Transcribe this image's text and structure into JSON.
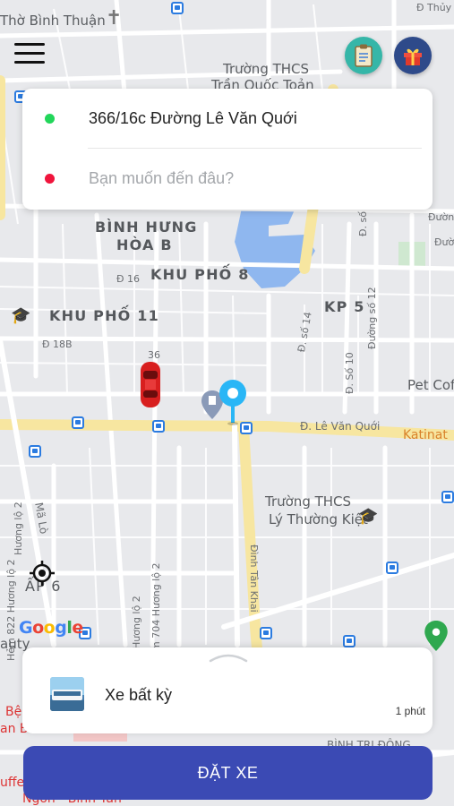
{
  "map": {
    "labels": {
      "tho_binh_thuan": "Thờ Bình Thuận",
      "da_thuy": "Đ Thủy",
      "truong_thcs_1": "Trường THCS",
      "tran_quoc_toan": "Trần Quốc Toản",
      "binh_hung": "BÌNH HƯNG",
      "hoa_b": "HÒA B",
      "khu_pho_8": "KHU PHỐ 8",
      "kp_5": "KP 5",
      "khu_pho_11": "KHU PHỐ 11",
      "d16": "Đ 16",
      "d18b": "Đ 18B",
      "d_so_14": "Đ. số 14",
      "d_so_10": "Đ. Số 10",
      "duong_so_12": "Đường số 12",
      "d_so_right": "Đ. số",
      "duong_so_right": "Đường số",
      "duong_so_16": "Đường số 16",
      "d36": "36",
      "le_van_quoi": "Đ. Lê Văn Quới",
      "pet_coffee": "Pet Cof",
      "katinat": "Katinat",
      "truong_thcs_2": "Trường THCS",
      "ly_thuong_kiet": "Lý Thường Kiệt",
      "ma_lo": "Mã Lò",
      "huong_lo_2_a": "Hương lộ 2",
      "hem_822": "Hẻm 822 Hương lộ 2",
      "hem_704": "Hẻm 704 Hương lộ 2",
      "huong_lo_2_b": "Hương lộ 2",
      "dinh_tan_khai": "Đình Tân Khai",
      "ap_6": "ẤP 6",
      "auty": "auty",
      "be": "Bệ",
      "an_b": "an B",
      "binh_tri_dong": "BÌNH TRỊ ĐÔNG",
      "uffe": "uffe",
      "ngon_binh_tan": "Ngon - Bình Tân"
    },
    "google_logo": [
      "G",
      "o",
      "o",
      "g",
      "l",
      "e"
    ],
    "google_colors": [
      "#4285F4",
      "#EA4335",
      "#FBBC05",
      "#4285F4",
      "#34A853",
      "#EA4335"
    ],
    "route_color": "#f7e6a0",
    "water_color": "#8fb7ef",
    "pin_color": "#29b6f6",
    "car_color": "#d81f1f"
  },
  "toolbar": {
    "menu_icon": "hamburger-menu-icon",
    "history_icon": "clipboard-icon",
    "gift_icon": "gift-icon"
  },
  "address": {
    "pickup": "366/16c Đường Lê Văn Quới",
    "destination_placeholder": "Bạn muốn đến đâu?"
  },
  "vehicle": {
    "name": "Xe bất kỳ",
    "eta": "1 phút"
  },
  "book_button": "ĐẶT XE",
  "colors": {
    "primary": "#3b4ab4",
    "pickup_dot": "#22d65a",
    "dest_dot": "#f0143c"
  }
}
